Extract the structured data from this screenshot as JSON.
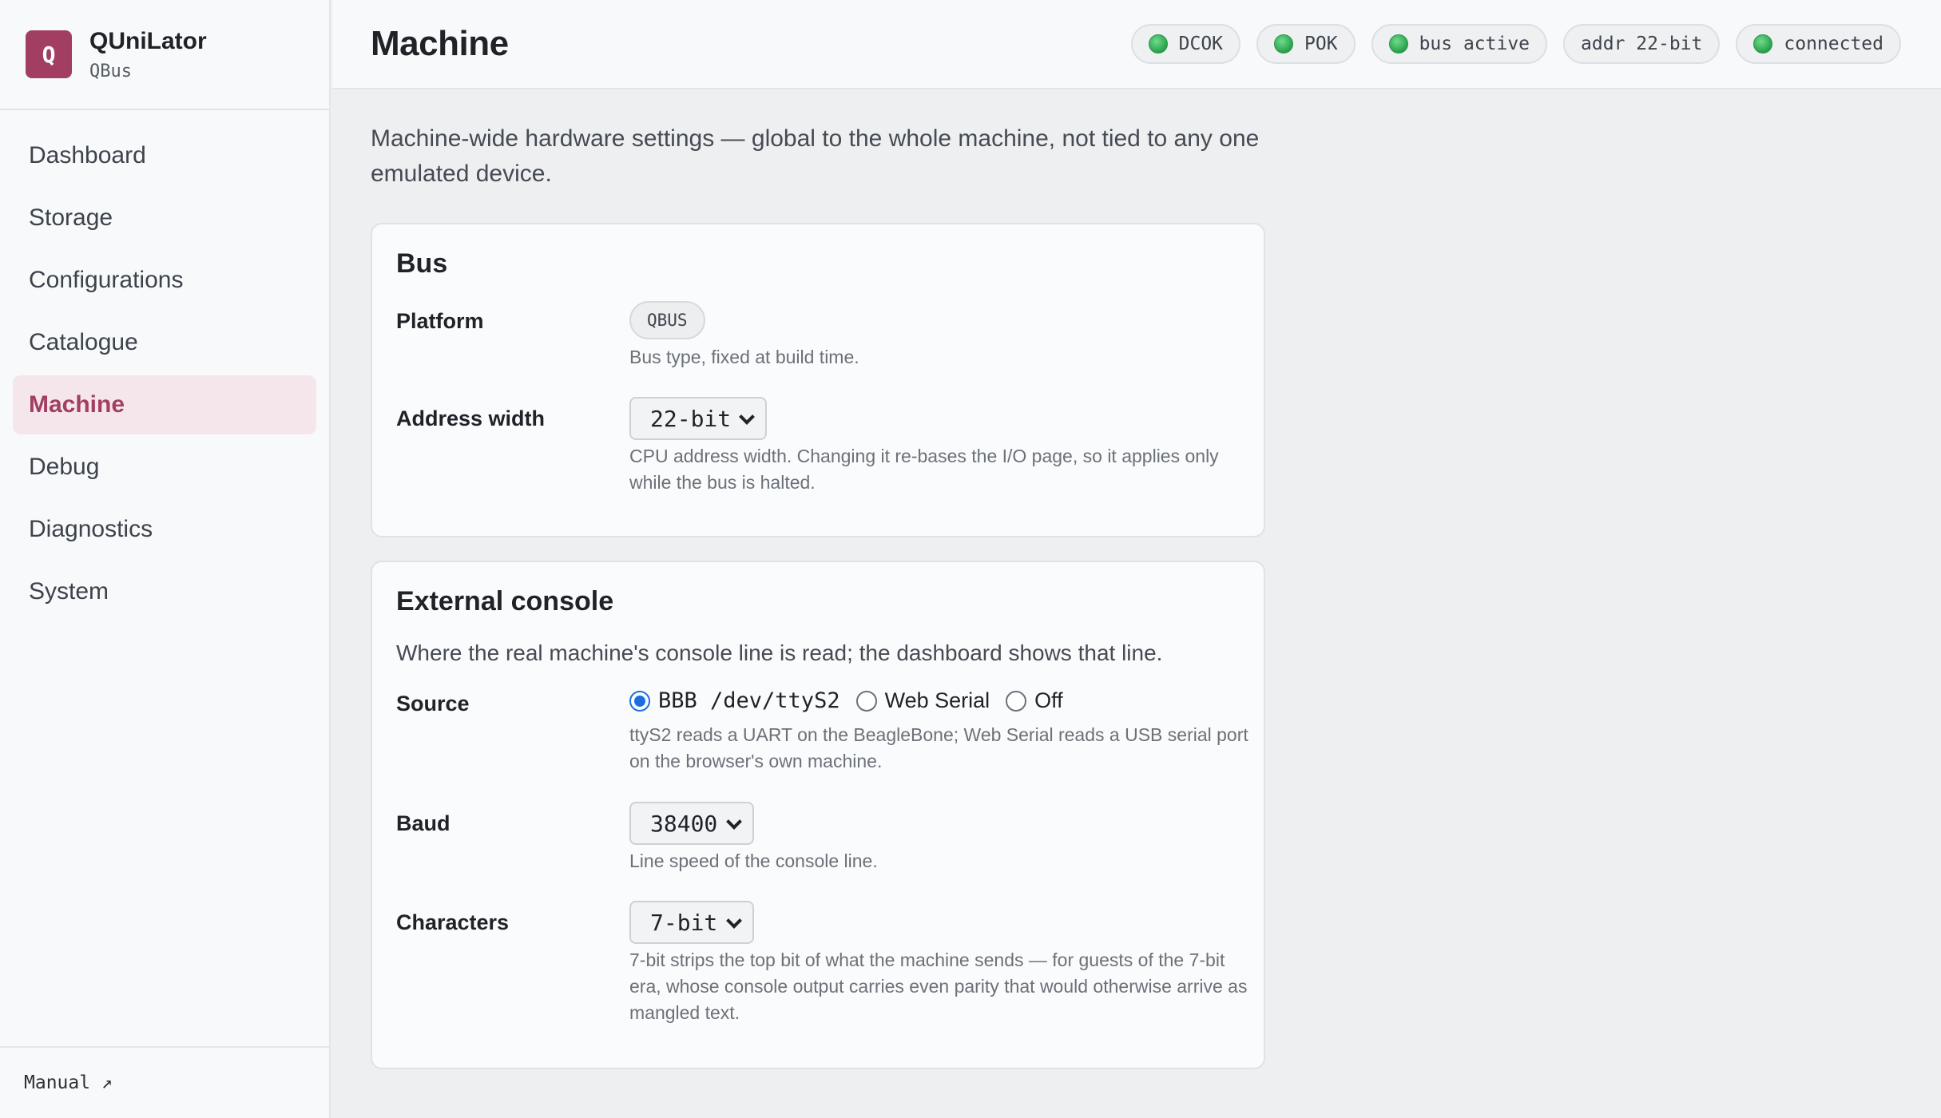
{
  "app": {
    "logo_letter": "Q",
    "name": "QUniLator",
    "subtitle": "QBus"
  },
  "sidebar": {
    "items": [
      {
        "label": "Dashboard"
      },
      {
        "label": "Storage"
      },
      {
        "label": "Configurations"
      },
      {
        "label": "Catalogue"
      },
      {
        "label": "Machine",
        "active": true
      },
      {
        "label": "Debug"
      },
      {
        "label": "Diagnostics"
      },
      {
        "label": "System"
      }
    ],
    "manual_label": "Manual ↗"
  },
  "header": {
    "title": "Machine",
    "status_chips": [
      {
        "label": "DCOK",
        "indicator": true
      },
      {
        "label": "POK",
        "indicator": true
      },
      {
        "label": "bus active",
        "indicator": true
      },
      {
        "label": "addr 22-bit",
        "indicator": false
      },
      {
        "label": "connected",
        "indicator": true
      }
    ],
    "indicator_color": "#3cb55e"
  },
  "main": {
    "intro": "Machine-wide hardware settings — global to the whole machine, not tied to any one emulated device.",
    "bus": {
      "title": "Bus",
      "platform_label": "Platform",
      "platform_value": "QBUS",
      "platform_help": "Bus type, fixed at build time.",
      "address_label": "Address width",
      "address_value": "22-bit",
      "address_help": "CPU address width. Changing it re-bases the I/O page, so it applies only while the bus is halted."
    },
    "console": {
      "title": "External console",
      "description": "Where the real machine's console line is read; the dashboard shows that line.",
      "source_label": "Source",
      "source_options": [
        {
          "label": "BBB /dev/ttyS2",
          "selected": true
        },
        {
          "label": "Web Serial",
          "selected": false
        },
        {
          "label": "Off",
          "selected": false
        }
      ],
      "source_help": "ttyS2 reads a UART on the BeagleBone; Web Serial reads a USB serial port on the browser's own machine.",
      "baud_label": "Baud",
      "baud_value": "38400",
      "baud_help": "Line speed of the console line.",
      "chars_label": "Characters",
      "chars_value": "7-bit",
      "chars_help": "7-bit strips the top bit of what the machine sends — for guests of the 7-bit era, whose console output carries even parity that would otherwise arrive as mangled text."
    }
  },
  "colors": {
    "accent": "#a23e62",
    "radio_selected": "#1a6fe0"
  }
}
